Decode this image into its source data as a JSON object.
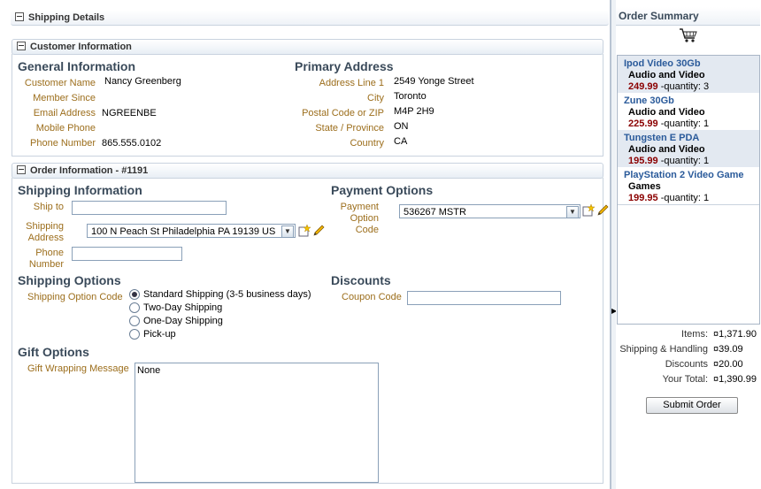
{
  "shipping_details": {
    "title": "Shipping Details"
  },
  "customer_info": {
    "bar": "Customer Information",
    "general": {
      "heading": "General Information",
      "customer_name_label": "Customer Name",
      "customer_name": "Nancy Greenberg",
      "member_since_label": "Member Since",
      "member_since": "",
      "email_label": "Email Address",
      "email": "NGREENBE",
      "mobile_label": "Mobile Phone",
      "mobile": "",
      "phone_label": "Phone Number",
      "phone": "865.555.0102"
    },
    "address": {
      "heading": "Primary Address",
      "line1_label": "Address Line 1",
      "line1": "2549 Yonge Street",
      "city_label": "City",
      "city": "Toronto",
      "postal_label": "Postal Code or ZIP",
      "postal": "M4P 2H9",
      "state_label": "State / Province",
      "state": "ON",
      "country_label": "Country",
      "country": "CA"
    }
  },
  "order_info": {
    "bar": "Order Information - #1191",
    "shipping_info": {
      "heading": "Shipping Information",
      "ship_to_label": "Ship to",
      "ship_to": "",
      "ship_addr_label_1": "Shipping",
      "ship_addr_label_2": "Address",
      "ship_addr_value": "100 N Peach St Philadelphia PA  19139 US",
      "phone_label_1": "Phone",
      "phone_label_2": "Number",
      "phone": ""
    },
    "payment": {
      "heading": "Payment Options",
      "code_label_1": "Payment",
      "code_label_2": "Option",
      "code_label_3": "Code",
      "code_value": "536267 MSTR"
    },
    "shipping_options": {
      "heading": "Shipping Options",
      "code_label": "Shipping Option Code",
      "options": [
        "Standard Shipping (3-5 business days)",
        "Two-Day Shipping",
        "One-Day Shipping",
        "Pick-up"
      ],
      "selected": 0
    },
    "discounts": {
      "heading": "Discounts",
      "coupon_label": "Coupon Code",
      "coupon": ""
    },
    "gift": {
      "heading": "Gift Options",
      "message_label": "Gift Wrapping Message",
      "message": "None"
    }
  },
  "order_summary": {
    "title": "Order Summary",
    "icon": "shopping-cart-icon",
    "items": [
      {
        "name": "Ipod Video 30Gb",
        "category": "Audio and Video",
        "price": "249.99",
        "qty": "-quantity: 3"
      },
      {
        "name": "Zune 30Gb",
        "category": "Audio and Video",
        "price": "225.99",
        "qty": "-quantity: 1"
      },
      {
        "name": "Tungsten E PDA",
        "category": "Audio and Video",
        "price": "195.99",
        "qty": "-quantity: 1"
      },
      {
        "name": "PlayStation 2 Video Game",
        "category": "Games",
        "price": "199.95",
        "qty": "-quantity: 1"
      }
    ],
    "totals": {
      "items_label": "Items:",
      "items": "¤1,371.90",
      "shipping_label": "Shipping & Handling",
      "shipping": "¤39.09",
      "discounts_label": "Discounts",
      "discounts": "¤20.00",
      "total_label": "Your Total:",
      "total": "¤1,390.99"
    },
    "submit_label": "Submit Order"
  },
  "colors": {
    "label": "#9c6e1c",
    "heading": "#3a4a5a",
    "price": "#8b0000",
    "item_title": "#2a5a9a",
    "row_alt": "#e3e9f1"
  }
}
